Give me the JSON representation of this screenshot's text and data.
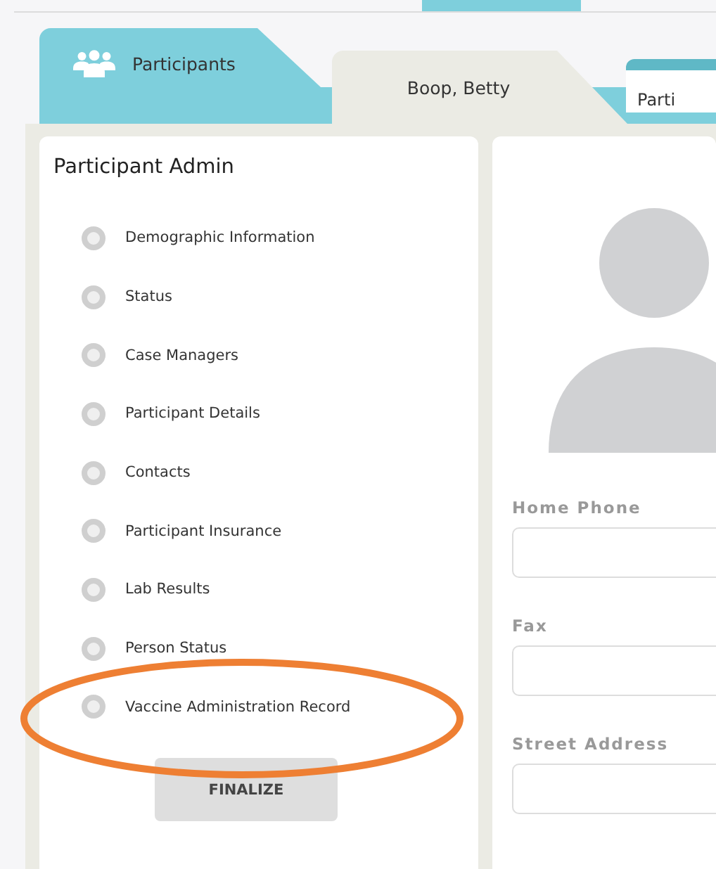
{
  "tabs": [
    {
      "kind": "home",
      "label": "Participants",
      "selected": false
    },
    {
      "kind": "record",
      "label": "Boop, Betty",
      "selected": true
    },
    {
      "kind": "section",
      "label": "Parti",
      "selected": false
    }
  ],
  "admin": {
    "title": "Participant Admin",
    "items": [
      {
        "label": "Demographic Information",
        "selected": false
      },
      {
        "label": "Status",
        "selected": false
      },
      {
        "label": "Case Managers",
        "selected": false
      },
      {
        "label": "Participant Details",
        "selected": false
      },
      {
        "label": "Contacts",
        "selected": false
      },
      {
        "label": "Participant Insurance",
        "selected": false
      },
      {
        "label": "Lab Results",
        "selected": false
      },
      {
        "label": "Person Status",
        "selected": false
      },
      {
        "label": "Vaccine Administration Record",
        "selected": false
      }
    ],
    "button": "FINALIZE"
  },
  "profile": {
    "fields": [
      {
        "label": "Home Phone"
      },
      {
        "label": "Fax"
      },
      {
        "label": "Street Address"
      }
    ]
  },
  "annotation": {
    "color": "#ee7f33"
  }
}
